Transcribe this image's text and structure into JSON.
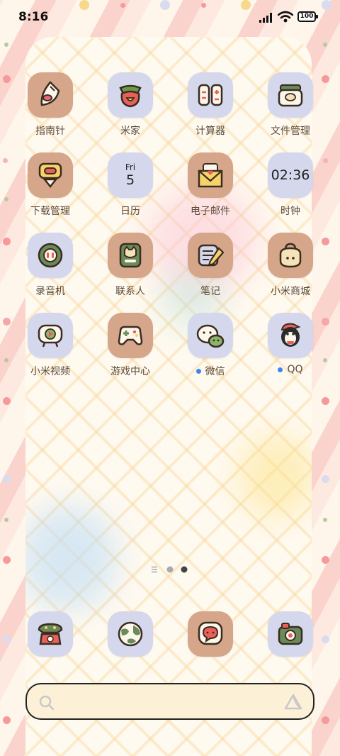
{
  "status_bar": {
    "time": "8:16",
    "battery": "100"
  },
  "apps": [
    {
      "label": "指南针",
      "icon": "compass-icon"
    },
    {
      "label": "米家",
      "icon": "mijia-icon"
    },
    {
      "label": "计算器",
      "icon": "calculator-icon"
    },
    {
      "label": "文件管理",
      "icon": "file-manager-icon"
    },
    {
      "label": "下载管理",
      "icon": "download-manager-icon"
    },
    {
      "label": "日历",
      "icon": "calendar-icon",
      "day": "Fri",
      "date": "5"
    },
    {
      "label": "电子邮件",
      "icon": "email-icon"
    },
    {
      "label": "时钟",
      "icon": "clock-icon",
      "time": "02:36"
    },
    {
      "label": "录音机",
      "icon": "recorder-icon"
    },
    {
      "label": "联系人",
      "icon": "contacts-icon"
    },
    {
      "label": "笔记",
      "icon": "notes-icon"
    },
    {
      "label": "小米商城",
      "icon": "mi-store-icon"
    },
    {
      "label": "小米视频",
      "icon": "mi-video-icon"
    },
    {
      "label": "游戏中心",
      "icon": "game-center-icon"
    },
    {
      "label": "微信",
      "icon": "wechat-icon",
      "new": true
    },
    {
      "label": "QQ",
      "icon": "qq-icon",
      "new": true
    }
  ],
  "pager": {
    "pages": 2,
    "current": 2
  },
  "dock": [
    {
      "icon": "phone-icon"
    },
    {
      "icon": "browser-icon"
    },
    {
      "icon": "messages-icon"
    },
    {
      "icon": "camera-icon"
    }
  ],
  "search_bar": {
    "left_icon": "search-icon",
    "right_icon": "assistant-icon"
  }
}
